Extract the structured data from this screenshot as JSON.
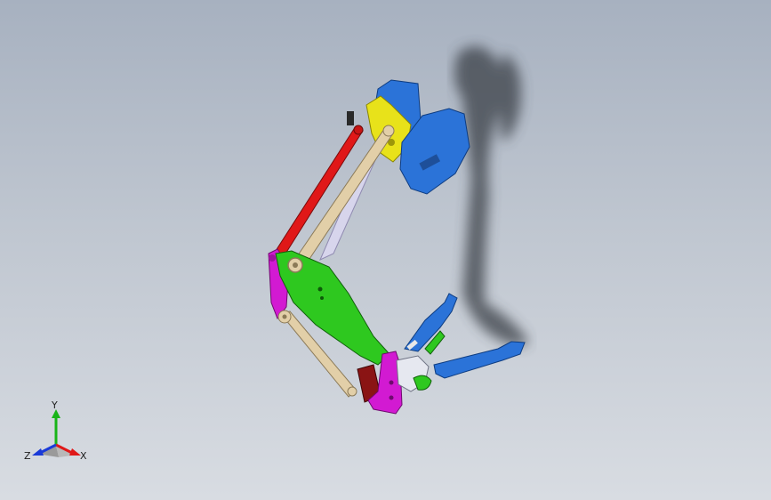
{
  "viewport": {
    "background_top": "#a7b1c0",
    "background_bottom": "#d8dce2"
  },
  "model": {
    "parts": [
      {
        "name": "base-plate-blue",
        "color": "#2b73d8"
      },
      {
        "name": "upper-link-red",
        "color": "#e01818"
      },
      {
        "name": "parallel-link-tan",
        "color": "#e2cfa8"
      },
      {
        "name": "bracket-yellow",
        "color": "#e8e21a"
      },
      {
        "name": "main-arm-green",
        "color": "#2ec81f"
      },
      {
        "name": "elbow-bracket-magenta",
        "color": "#d21ad2"
      },
      {
        "name": "wrist-block-darkred",
        "color": "#8a1414"
      },
      {
        "name": "gripper-jaw-blue",
        "color": "#2b73d8"
      }
    ]
  },
  "triad": {
    "x_label": "X",
    "y_label": "Y",
    "z_label": "Z",
    "x_color": "#e01818",
    "y_color": "#18b418",
    "z_color": "#1a3ad8"
  }
}
